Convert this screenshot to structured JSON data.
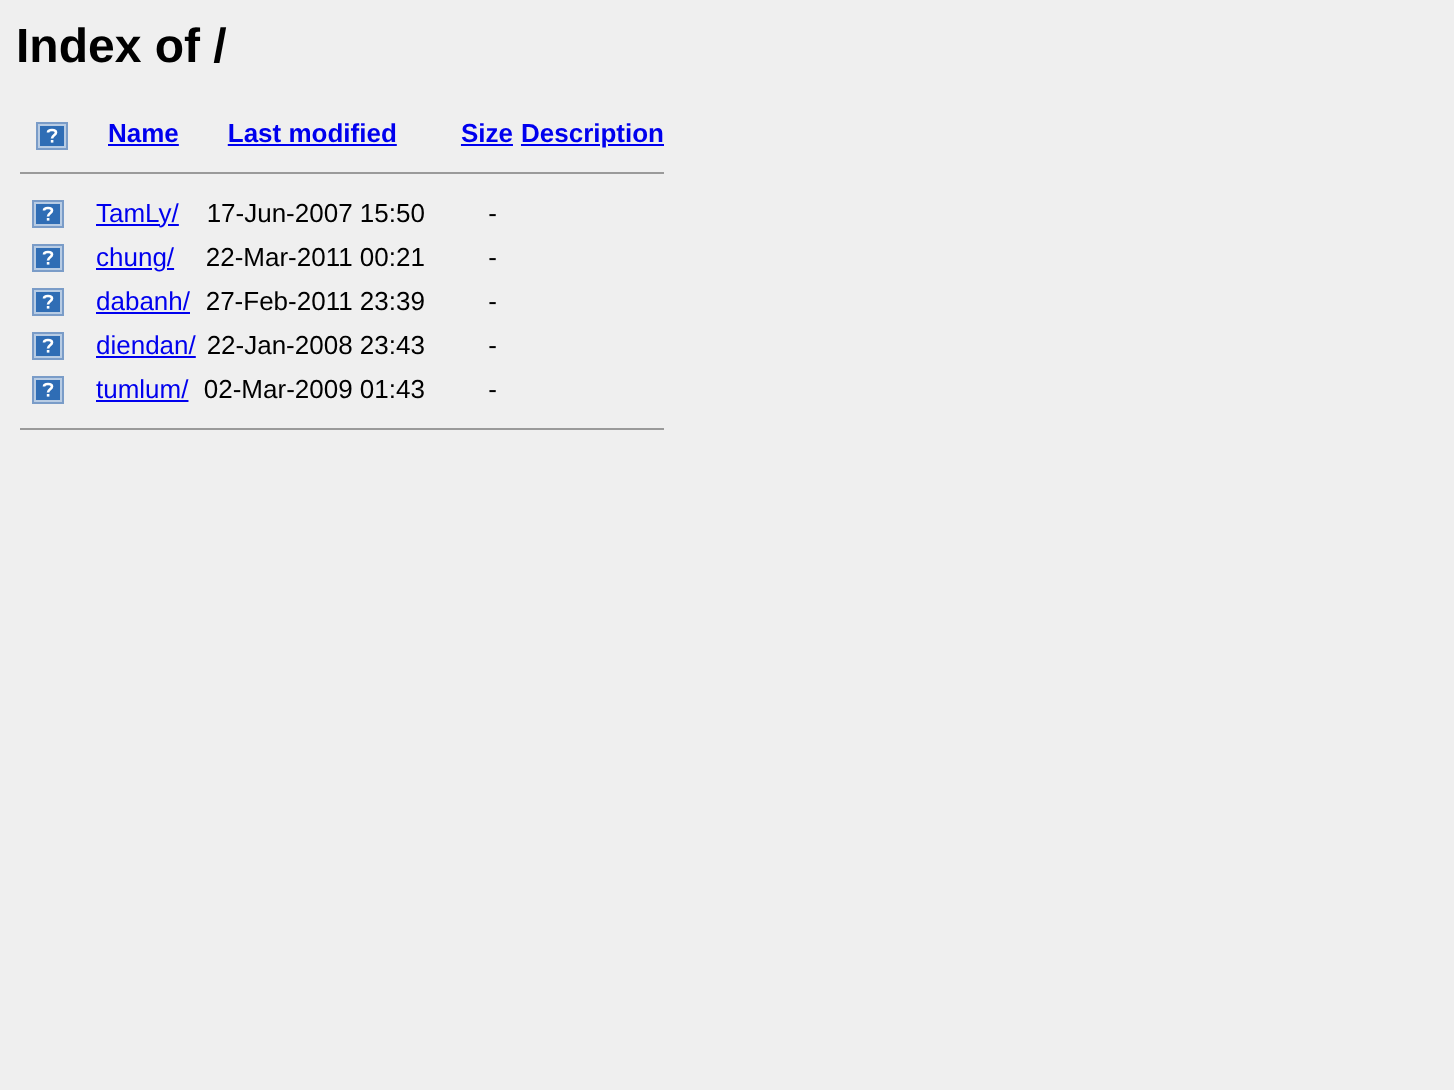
{
  "title": "Index of /",
  "columns": [
    "Name",
    "Last modified",
    "Size",
    "Description"
  ],
  "rows": [
    {
      "name": "TamLy/",
      "modified": "17-Jun-2007 15:50",
      "size": "-"
    },
    {
      "name": "chung/",
      "modified": "22-Mar-2011 00:21",
      "size": "-"
    },
    {
      "name": "dabanh/",
      "modified": "27-Feb-2011 23:39",
      "size": "-"
    },
    {
      "name": "diendan/",
      "modified": "22-Jan-2008 23:43",
      "size": "-"
    },
    {
      "name": "tumlum/",
      "modified": "02-Mar-2009 01:43",
      "size": "-"
    }
  ]
}
